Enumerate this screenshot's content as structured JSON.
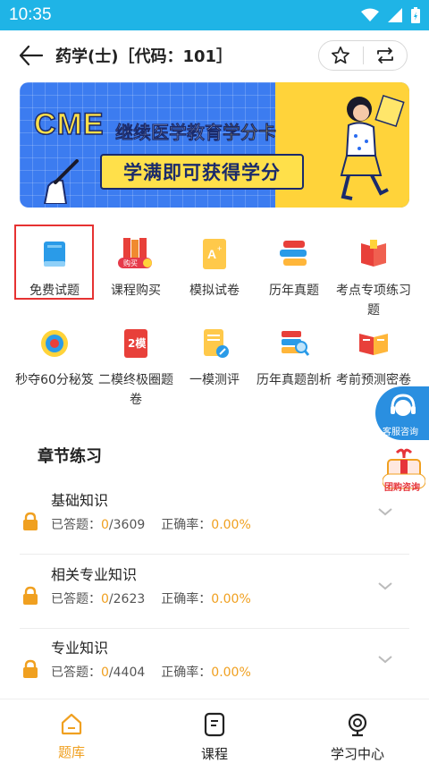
{
  "status": {
    "time": "10:35"
  },
  "header": {
    "title": "药学(士)［代码：101］"
  },
  "banner": {
    "headline_main": "CME",
    "headline_rest": "继续医学教育",
    "headline_accent": "学分卡",
    "sub": "学满即可获得学分"
  },
  "grid": {
    "row1": [
      {
        "label": "免费试题",
        "icon": "book-icon",
        "selected": true
      },
      {
        "label": "课程购买",
        "icon": "books-buy-icon"
      },
      {
        "label": "模拟试卷",
        "icon": "paper-aplus-icon"
      },
      {
        "label": "历年真题",
        "icon": "stack-icon"
      },
      {
        "label": "考点专项练习题",
        "icon": "red-book-icon"
      }
    ],
    "row2": [
      {
        "label": "秒夺60分秘笈",
        "icon": "target-icon"
      },
      {
        "label": "二模终极圈题卷",
        "icon": "exam-2-icon"
      },
      {
        "label": "一模测评",
        "icon": "doc-pencil-icon"
      },
      {
        "label": "历年真题剖析",
        "icon": "magnify-stack-icon"
      },
      {
        "label": "考前预测密卷",
        "icon": "open-book-icon"
      }
    ]
  },
  "section_title": "章节练习",
  "chapters": [
    {
      "name": "基础知识",
      "answered_label": "已答题：",
      "answered": "0",
      "total": "/3609",
      "rate_label": "正确率：",
      "rate": "0.00%"
    },
    {
      "name": "相关专业知识",
      "answered_label": "已答题：",
      "answered": "0",
      "total": "/2623",
      "rate_label": "正确率：",
      "rate": "0.00%"
    },
    {
      "name": "专业知识",
      "answered_label": "已答题：",
      "answered": "0",
      "total": "/4404",
      "rate_label": "正确率：",
      "rate": "0.00%"
    }
  ],
  "floating": {
    "service": "客服咨询",
    "group": "团购咨询"
  },
  "tabs": [
    {
      "label": "题库",
      "icon": "home-icon",
      "active": true
    },
    {
      "label": "课程",
      "icon": "course-icon"
    },
    {
      "label": "学习中心",
      "icon": "learning-center-icon"
    }
  ],
  "colors": {
    "status_bar": "#1fb4e6",
    "accent": "#f0a020",
    "select_border": "#e63232"
  }
}
